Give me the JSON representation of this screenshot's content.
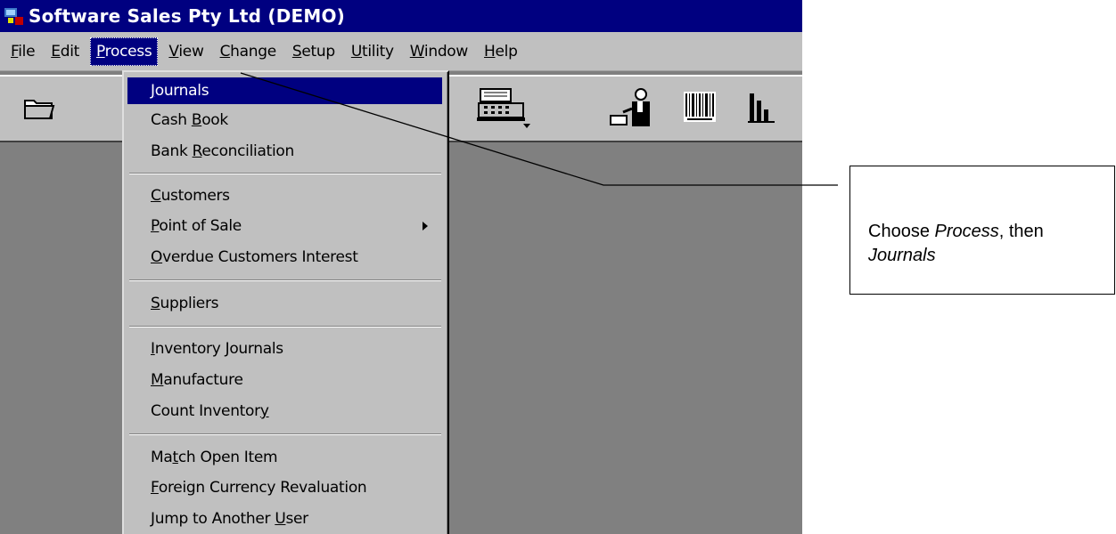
{
  "window": {
    "title": "Software Sales Pty Ltd (DEMO)"
  },
  "menubar": {
    "items": [
      {
        "pre": "",
        "ul": "F",
        "post": "ile"
      },
      {
        "pre": "",
        "ul": "E",
        "post": "dit"
      },
      {
        "pre": "",
        "ul": "P",
        "post": "rocess"
      },
      {
        "pre": "",
        "ul": "V",
        "post": "iew"
      },
      {
        "pre": "",
        "ul": "C",
        "post": "hange"
      },
      {
        "pre": "",
        "ul": "S",
        "post": "etup"
      },
      {
        "pre": "",
        "ul": "U",
        "post": "tility"
      },
      {
        "pre": "",
        "ul": "W",
        "post": "indow"
      },
      {
        "pre": "",
        "ul": "H",
        "post": "elp"
      }
    ],
    "active": "Process"
  },
  "toolbar": {
    "buttons": [
      "open-folder-icon",
      "cash-register-icon",
      "salesperson-icon",
      "barcode-icon",
      "bar-chart-icon"
    ]
  },
  "process_menu": {
    "items": [
      {
        "pre": "",
        "ul": "J",
        "post": "ournals"
      },
      {
        "pre": "Cash ",
        "ul": "B",
        "post": "ook"
      },
      {
        "pre": "Bank ",
        "ul": "R",
        "post": "econciliation"
      },
      {
        "pre": "",
        "ul": "C",
        "post": "ustomers"
      },
      {
        "pre": "",
        "ul": "P",
        "post": "oint of Sale"
      },
      {
        "pre": "",
        "ul": "O",
        "post": "verdue Customers Interest"
      },
      {
        "pre": "",
        "ul": "S",
        "post": "uppliers"
      },
      {
        "pre": "",
        "ul": "I",
        "post": "nventory Journals"
      },
      {
        "pre": "",
        "ul": "M",
        "post": "anufacture"
      },
      {
        "pre": "Count Inventor",
        "ul": "y",
        "post": ""
      },
      {
        "pre": "Ma",
        "ul": "t",
        "post": "ch Open Item"
      },
      {
        "pre": "",
        "ul": "F",
        "post": "oreign Currency Revaluation"
      },
      {
        "pre": "Jump to Another ",
        "ul": "U",
        "post": "ser"
      }
    ],
    "selected": "Journals",
    "submenu_item": "Point of Sale"
  },
  "callout": {
    "text_1": "Choose ",
    "text_2": "Process",
    "text_3": ", then",
    "text_4": "Journals"
  }
}
